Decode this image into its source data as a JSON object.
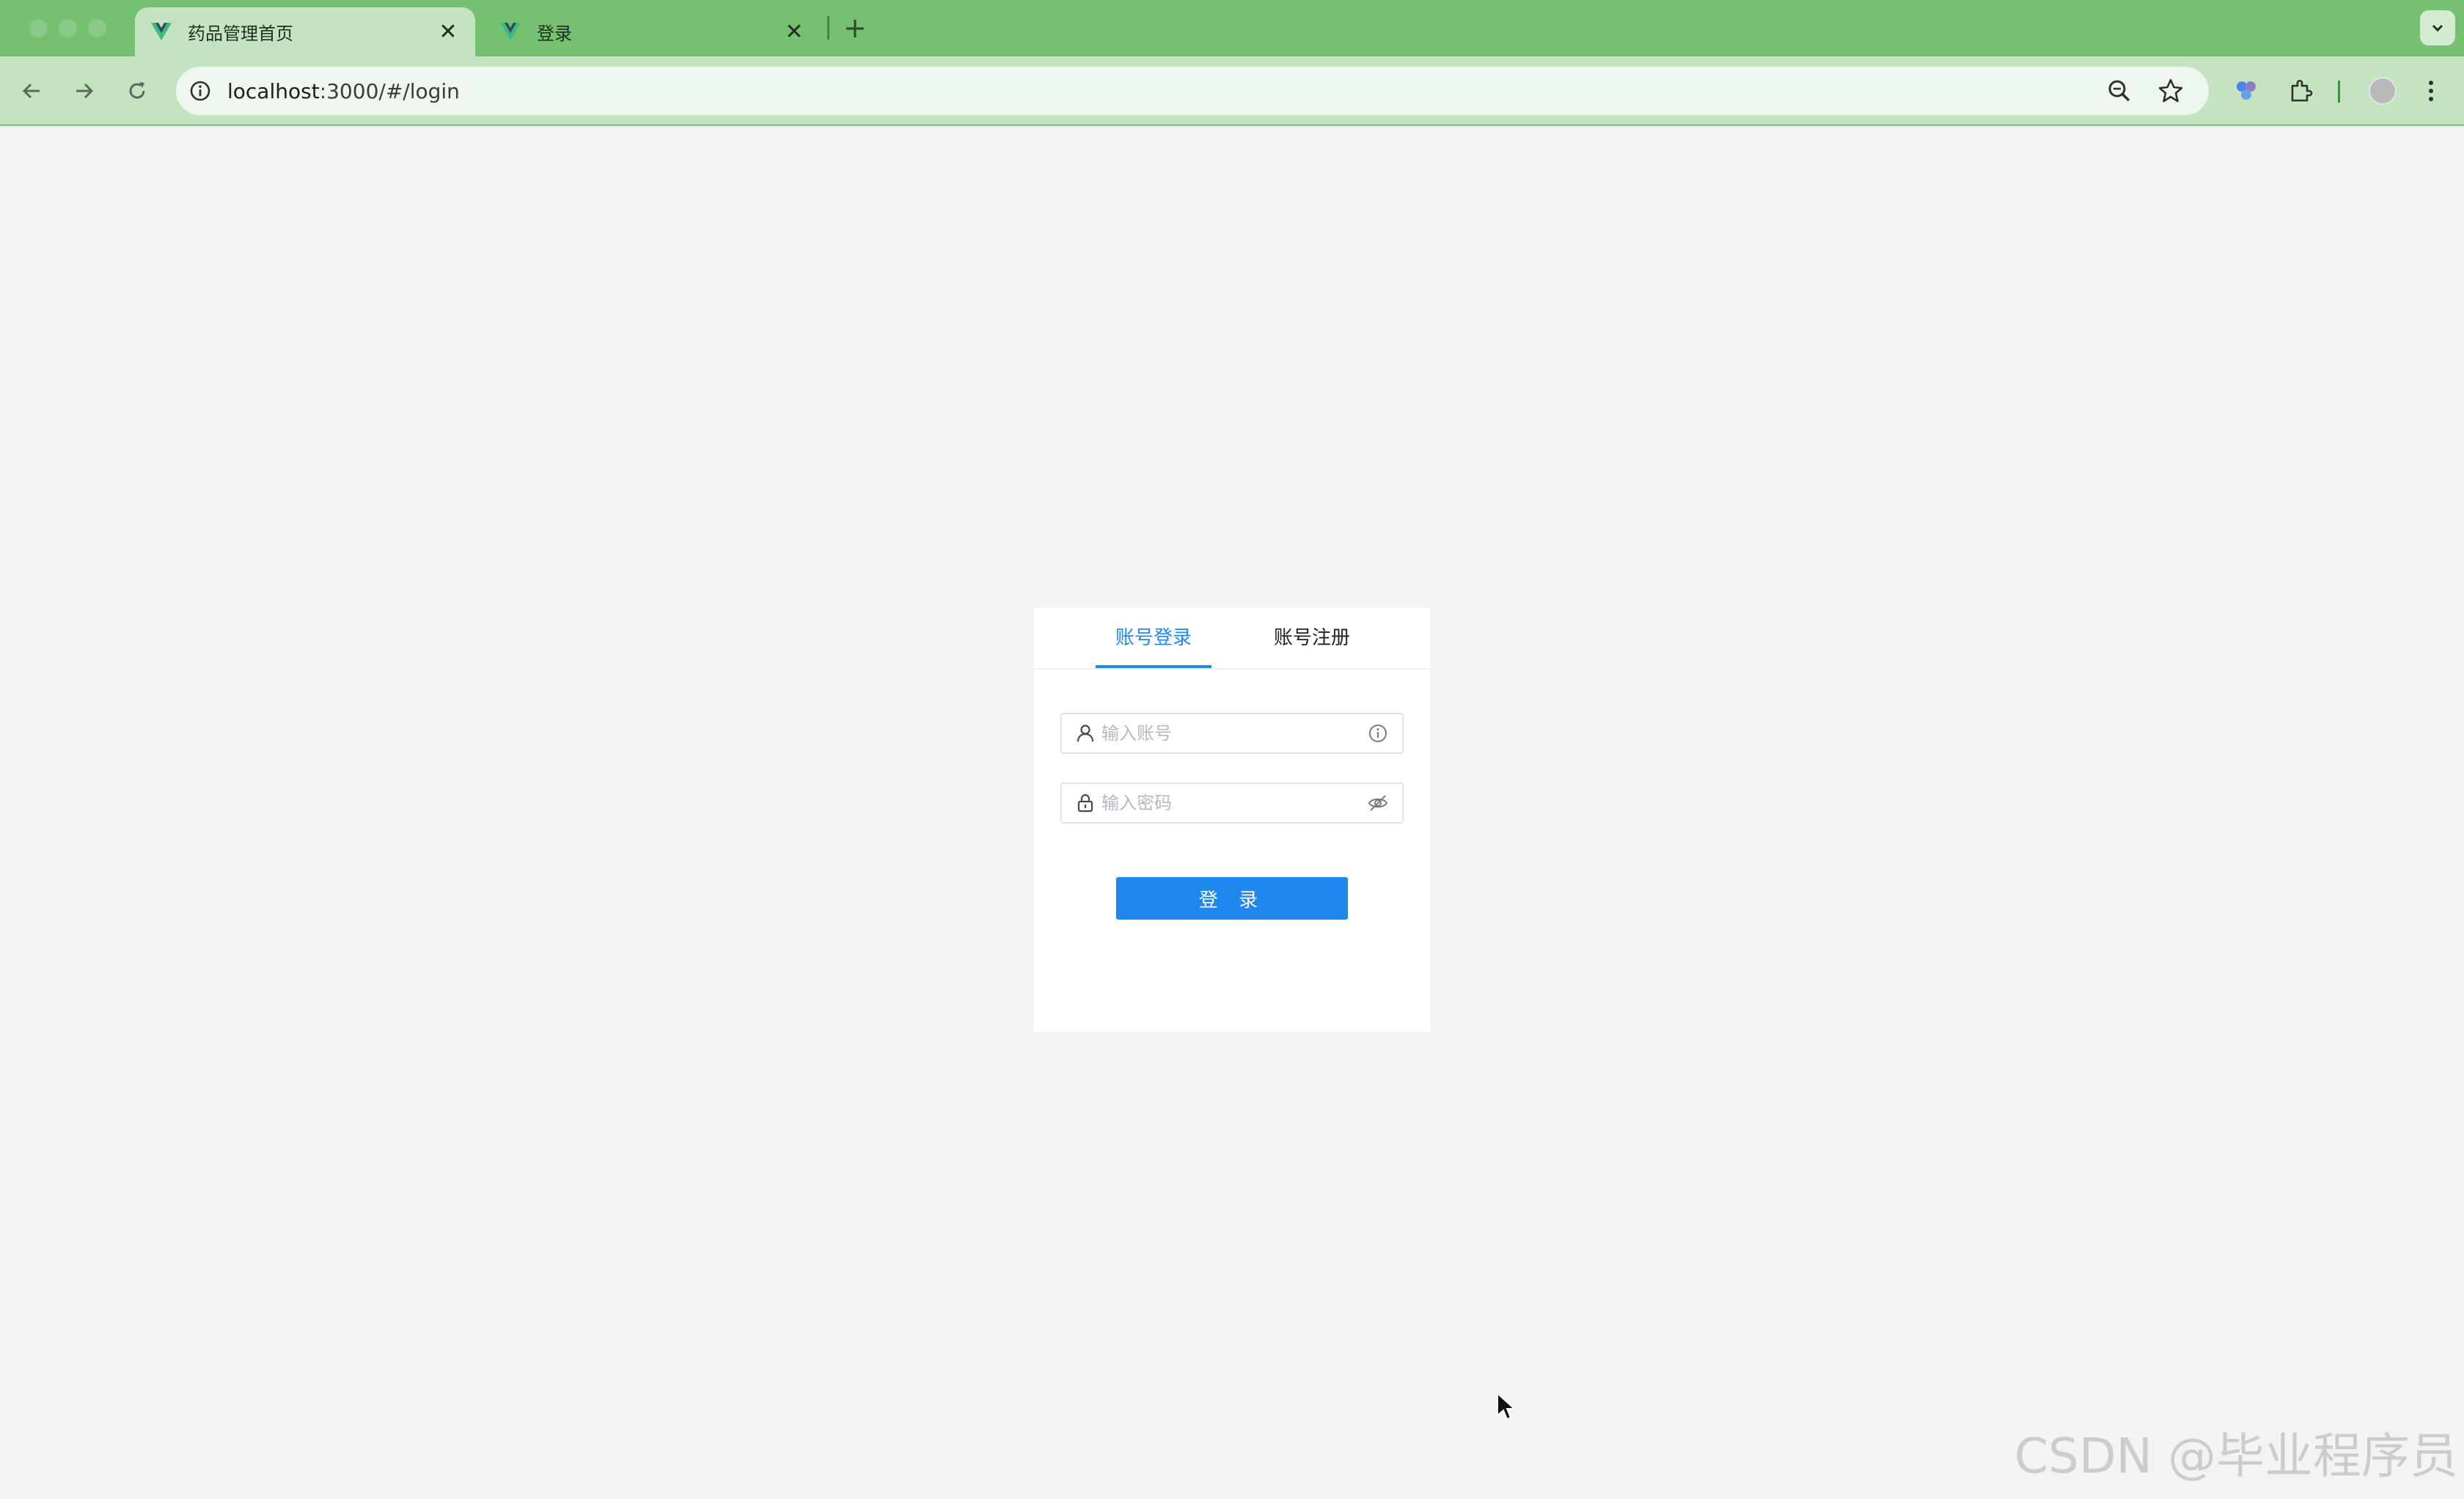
{
  "browser": {
    "tabs": [
      {
        "title": "药品管理首页",
        "active": true,
        "favicon": "vue-logo-icon"
      },
      {
        "title": "登录",
        "active": false,
        "favicon": "vue-logo-icon"
      }
    ],
    "close_glyph": "✕",
    "new_tab_glyph": "+",
    "url_host": "localhost",
    "url_rest": ":3000/#/login",
    "colors": {
      "tabbar": "#74c172",
      "toolbar": "#c4e3c1",
      "omnibox": "#eef7ed"
    }
  },
  "login_card": {
    "tabs": [
      {
        "label": "账号登录",
        "active": true
      },
      {
        "label": "账号注册",
        "active": false
      }
    ],
    "account": {
      "placeholder": "输入账号",
      "value": ""
    },
    "password": {
      "placeholder": "输入密码",
      "value": ""
    },
    "submit_label": "登 录",
    "accent_color": "#1e88f0"
  },
  "watermark": "CSDN @毕业程序员"
}
